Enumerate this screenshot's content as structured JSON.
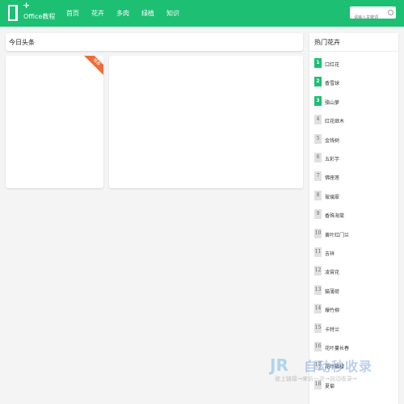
{
  "header": {
    "logo_text": "Office教程",
    "nav": [
      "首页",
      "花卉",
      "多肉",
      "绿植",
      "知识"
    ],
    "search_placeholder": "请输入关键词"
  },
  "main": {
    "section_title": "今日头条",
    "ribbon_label": "推荐"
  },
  "sidebar": {
    "title": "热门花卉",
    "items": [
      {
        "rank": "1",
        "label": "口红花"
      },
      {
        "rank": "2",
        "label": "香雪球"
      },
      {
        "rank": "3",
        "label": "骆山萝"
      },
      {
        "rank": "4",
        "label": "红花继木"
      },
      {
        "rank": "5",
        "label": "金钱树"
      },
      {
        "rank": "6",
        "label": "五彩芋"
      },
      {
        "rank": "7",
        "label": "佛座莲"
      },
      {
        "rank": "8",
        "label": "玻璃翠"
      },
      {
        "rank": "9",
        "label": "香殊海棠"
      },
      {
        "rank": "10",
        "label": "黄叶红门兰"
      },
      {
        "rank": "11",
        "label": "吉祥"
      },
      {
        "rank": "12",
        "label": "凌霄花"
      },
      {
        "rank": "13",
        "label": "猫薄荷"
      },
      {
        "rank": "14",
        "label": "爆竹柳"
      },
      {
        "rank": "15",
        "label": "卡特兰"
      },
      {
        "rank": "16",
        "label": "花叶蔓长春"
      },
      {
        "rank": "17",
        "label": "花叶福禄"
      },
      {
        "rank": "18",
        "label": "夏菊"
      }
    ]
  },
  "watermark": {
    "logo": "JR",
    "name": "自动秒收录",
    "tagline": "驶上链接→来访一次→自动收录→"
  }
}
